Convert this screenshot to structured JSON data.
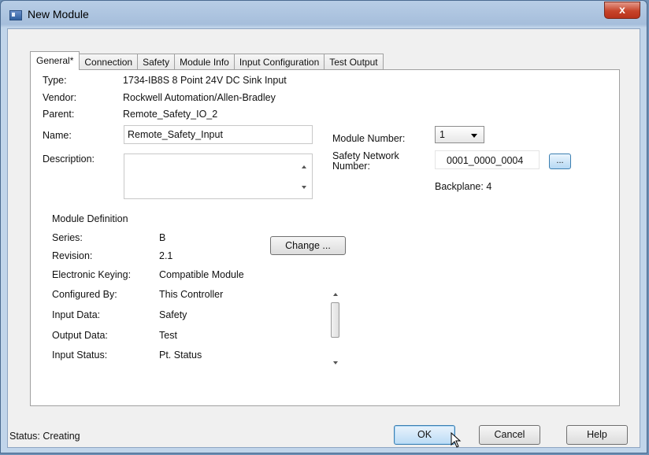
{
  "window": {
    "title": "New Module",
    "close_label": "x"
  },
  "tabs": [
    {
      "label": "General*"
    },
    {
      "label": "Connection"
    },
    {
      "label": "Safety"
    },
    {
      "label": "Module Info"
    },
    {
      "label": "Input Configuration"
    },
    {
      "label": "Test Output"
    }
  ],
  "general": {
    "type_label": "Type:",
    "type_value": "1734-IB8S 8 Point 24V DC Sink Input",
    "vendor_label": "Vendor:",
    "vendor_value": "Rockwell Automation/Allen-Bradley",
    "parent_label": "Parent:",
    "parent_value": "Remote_Safety_IO_2",
    "name_label": "Name:",
    "name_value": "Remote_Safety_Input",
    "description_label": "Description:",
    "description_value": "",
    "module_number_label": "Module Number:",
    "module_number_value": "1",
    "safety_network_label_1": "Safety Network",
    "safety_network_label_2": "Number:",
    "safety_network_value": "0001_0000_0004",
    "browse_label": "...",
    "backplane": "Backplane: 4"
  },
  "module_definition": {
    "title": "Module Definition",
    "change_label": "Change ...",
    "rows": [
      {
        "label": "Series:",
        "value": "B"
      },
      {
        "label": "Revision:",
        "value": "2.1"
      },
      {
        "label": "Electronic Keying:",
        "value": "Compatible Module"
      },
      {
        "label": "Configured By:",
        "value": "This Controller"
      },
      {
        "label": "Input Data:",
        "value": "Safety"
      },
      {
        "label": "Output Data:",
        "value": "Test"
      },
      {
        "label": "Input Status:",
        "value": "Pt. Status"
      }
    ]
  },
  "footer": {
    "status": "Status:  Creating",
    "ok_label": "OK",
    "cancel_label": "Cancel",
    "help_label": "Help"
  },
  "colors": {
    "accent": "#3c7fb1",
    "close_button": "#c7442b"
  },
  "icons": [
    "app-icon",
    "close-icon",
    "chevron-down-icon",
    "scroll-up-icon",
    "scroll-down-icon",
    "mouse-pointer-icon"
  ]
}
